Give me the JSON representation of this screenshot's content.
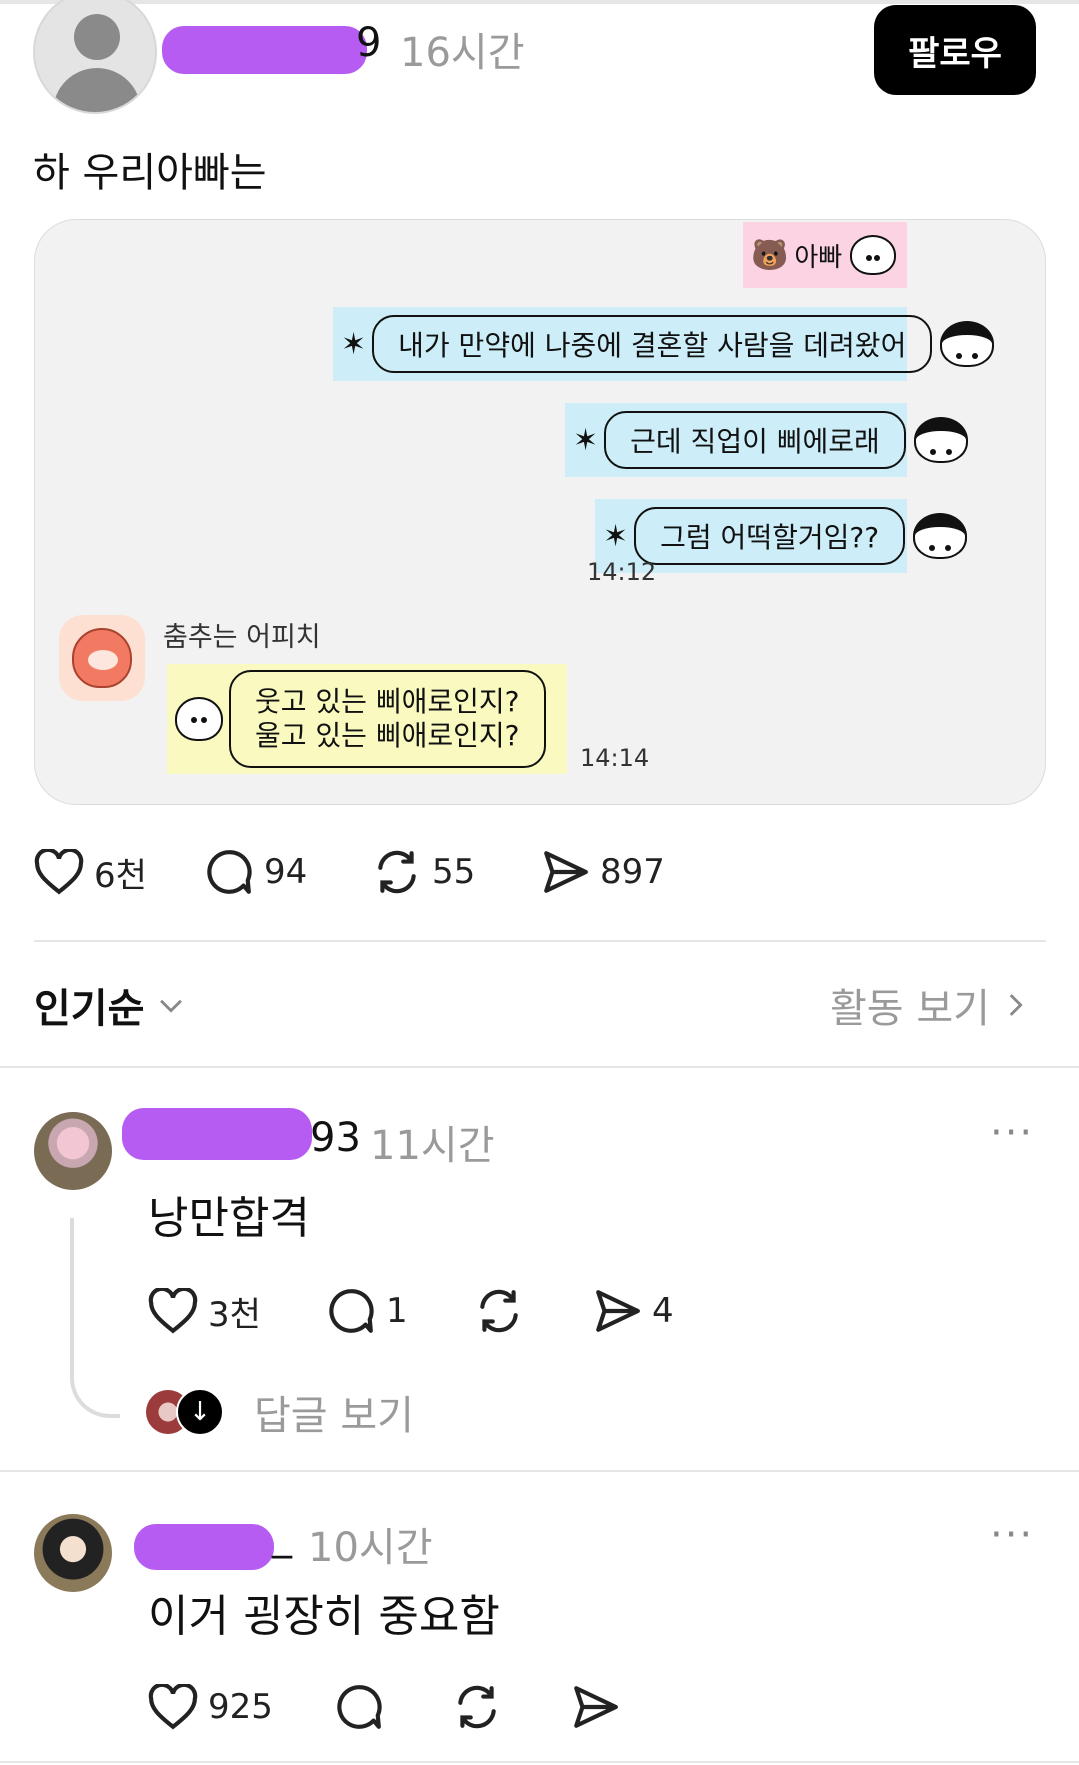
{
  "post": {
    "username_visible": "9",
    "time": "16시간",
    "follow_label": "팔로우",
    "text": "하 우리아빠는"
  },
  "chat": {
    "header_label": "아빠",
    "messages_right": [
      "내가 만약에 나중에 결혼할 사람을 데려왔어",
      "근데 직업이 삐에로래",
      "그럼 어떡할거임??"
    ],
    "time_right": "14:12",
    "sender_name": "춤추는 어피치",
    "reply_line1": "웃고 있는 삐애로인지?",
    "reply_line2": "울고 있는 삐애로인지?",
    "time_left": "14:14"
  },
  "post_actions": {
    "likes": "6천",
    "comments": "94",
    "reposts": "55",
    "shares": "897"
  },
  "sort": {
    "label": "인기순",
    "activity_link": "활동 보기"
  },
  "comments": [
    {
      "username_visible": "93",
      "time": "11시간",
      "text": "낭만합격",
      "likes": "3천",
      "comments": "1",
      "reposts": "",
      "shares": "4",
      "more": "···",
      "view_replies": "답글 보기"
    },
    {
      "username_visible": "_",
      "time": "10시간",
      "text": "이거 굉장히 중요함",
      "likes": "925",
      "comments": "",
      "reposts": "",
      "shares": "",
      "more": "···"
    }
  ],
  "colors": {
    "redaction": "#b65cf2",
    "follow_button": "#000000",
    "chat_card_bg": "#f2f2f2",
    "bubble_blue": "#cdeef8",
    "bubble_pink": "#fbd3e3",
    "bubble_yellow": "#fafac0"
  },
  "icons": [
    "person-placeholder-icon",
    "heart-icon",
    "comment-icon",
    "repost-icon",
    "share-icon",
    "chevron-down-icon",
    "chevron-right-icon",
    "more-icon",
    "arrow-down-icon"
  ]
}
